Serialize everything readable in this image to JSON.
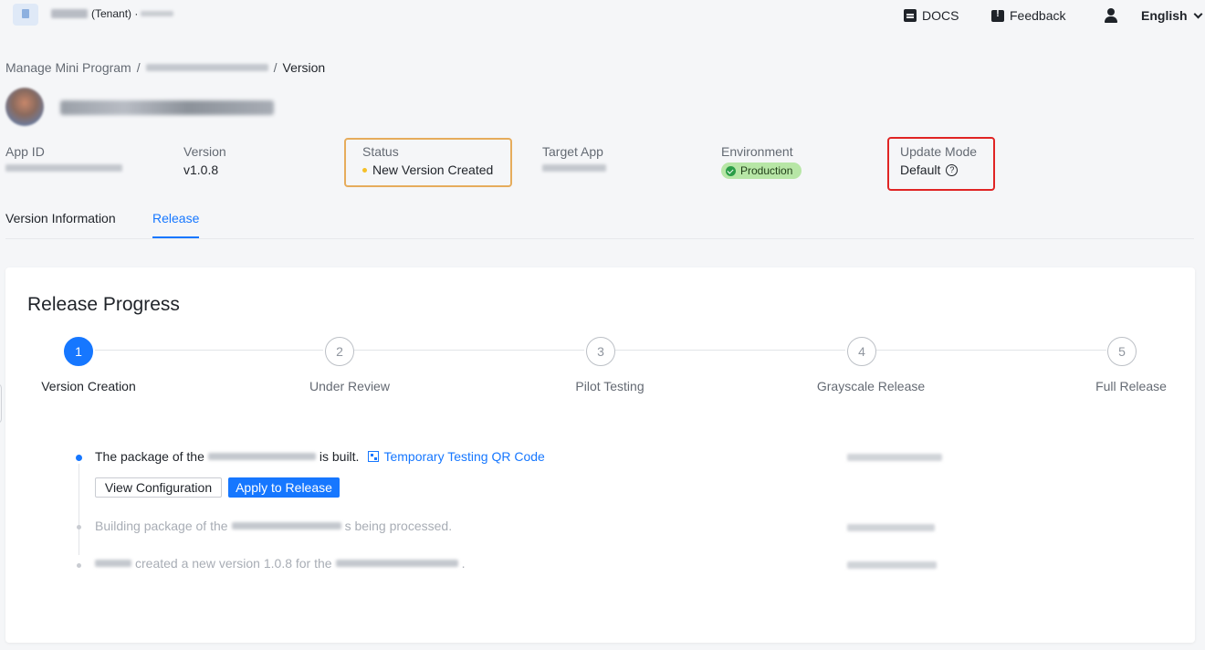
{
  "topbar": {
    "tenant_label": "(Tenant) ·",
    "docs_label": "DOCS",
    "feedback_label": "Feedback",
    "language_label": "English"
  },
  "breadcrumb": {
    "root": "Manage Mini Program",
    "separator": "/",
    "current": "Version"
  },
  "info": {
    "app_id_label": "App ID",
    "version_label": "Version",
    "version_value": "v1.0.8",
    "status_label": "Status",
    "status_value": "New Version Created",
    "target_app_label": "Target App",
    "environment_label": "Environment",
    "environment_value": "Production",
    "update_mode_label": "Update Mode",
    "update_mode_value": "Default",
    "help_glyph": "?"
  },
  "tabs": [
    {
      "label": "Version Information",
      "active": false
    },
    {
      "label": "Release",
      "active": true
    }
  ],
  "release": {
    "title": "Release Progress",
    "steps": [
      {
        "number": "1",
        "label": "Version Creation",
        "active": true
      },
      {
        "number": "2",
        "label": "Under Review",
        "active": false
      },
      {
        "number": "3",
        "label": "Pilot Testing",
        "active": false
      },
      {
        "number": "4",
        "label": "Grayscale Release",
        "active": false
      },
      {
        "number": "5",
        "label": "Full Release",
        "active": false
      }
    ],
    "timeline": {
      "main_prefix": "The package of the",
      "main_suffix": "is built.",
      "qr_link": "Temporary Testing QR Code",
      "view_config_button": "View Configuration",
      "apply_release_button": "Apply to Release",
      "building_prefix": "Building package of the",
      "building_suffix": "s being processed.",
      "created_middle": "created a new version 1.0.8 for the",
      "created_suffix": "."
    }
  },
  "colors": {
    "accent": "#1677ff",
    "status_dot": "#f5c028",
    "env_badge_bg": "#b7e6a6",
    "highlight_orange": "#e6ac5c",
    "highlight_red": "#e02424"
  }
}
